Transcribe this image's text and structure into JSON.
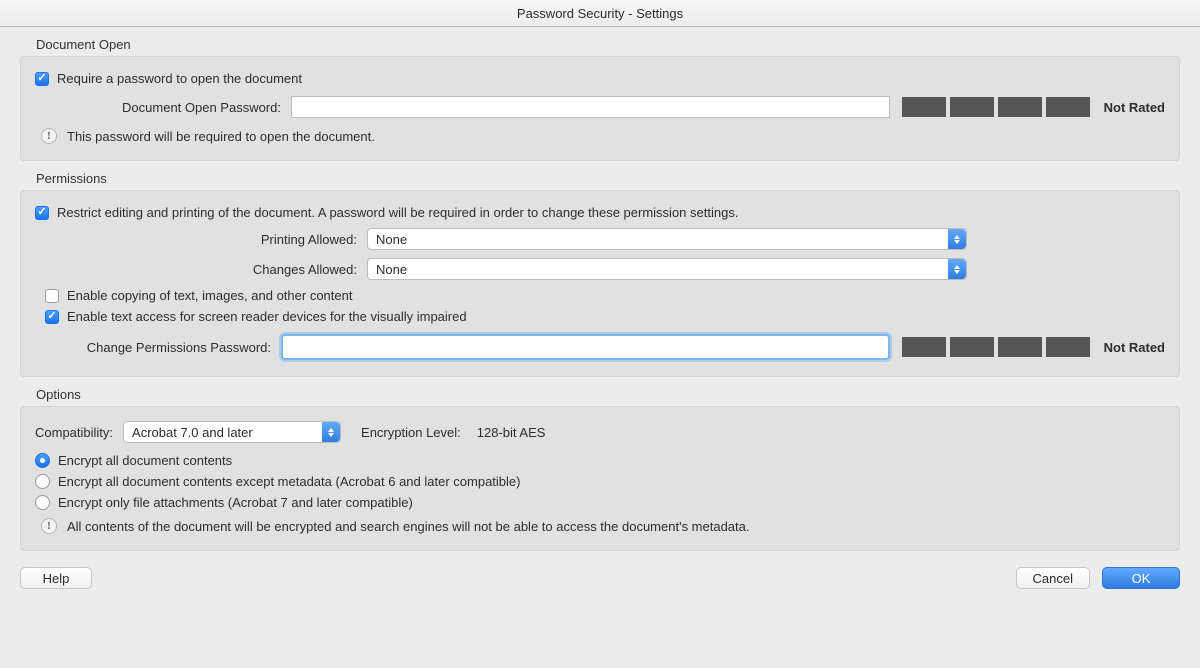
{
  "title": "Password Security - Settings",
  "documentOpen": {
    "section_label": "Document Open",
    "require_password_label": "Require a password to open the document",
    "require_password_checked": true,
    "password_field_label": "Document Open Password:",
    "password_value": "",
    "strength_label": "Not Rated",
    "info_text": "This password will be required to open the document."
  },
  "permissions": {
    "section_label": "Permissions",
    "restrict_label": "Restrict editing and printing of the document. A password will be required in order to change these permission settings.",
    "restrict_checked": true,
    "printing_label": "Printing Allowed:",
    "printing_value": "None",
    "changes_label": "Changes Allowed:",
    "changes_value": "None",
    "enable_copy_label": "Enable copying of text, images, and other content",
    "enable_copy_checked": false,
    "enable_reader_label": "Enable text access for screen reader devices for the visually impaired",
    "enable_reader_checked": true,
    "change_pw_label": "Change Permissions Password:",
    "change_pw_value": "",
    "strength_label": "Not Rated"
  },
  "options": {
    "section_label": "Options",
    "compatibility_label": "Compatibility:",
    "compatibility_value": "Acrobat 7.0 and later",
    "encryption_level_label": "Encryption  Level:",
    "encryption_level_value": "128-bit AES",
    "radio_all_label": "Encrypt all document contents",
    "radio_except_meta_label": "Encrypt all document contents except metadata (Acrobat 6 and later compatible)",
    "radio_attachments_label": "Encrypt only file attachments (Acrobat 7 and later compatible)",
    "radio_selected": "all",
    "info_text": "All contents of the document will be encrypted and search engines will not be able to access the document's metadata."
  },
  "footer": {
    "help": "Help",
    "cancel": "Cancel",
    "ok": "OK"
  }
}
